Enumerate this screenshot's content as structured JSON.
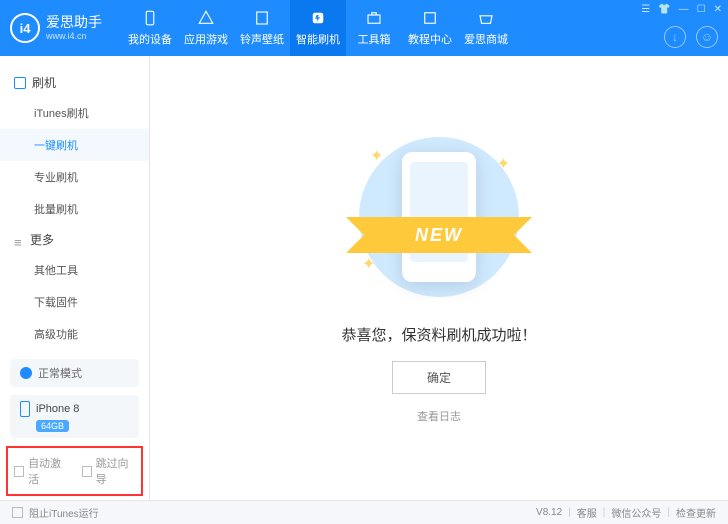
{
  "app": {
    "name": "爱思助手",
    "url": "www.i4.cn",
    "logo_text": "i4"
  },
  "nav": [
    {
      "label": "我的设备",
      "icon": "phone"
    },
    {
      "label": "应用游戏",
      "icon": "apps"
    },
    {
      "label": "铃声壁纸",
      "icon": "music"
    },
    {
      "label": "智能刷机",
      "icon": "flash",
      "active": true
    },
    {
      "label": "工具箱",
      "icon": "toolbox"
    },
    {
      "label": "教程中心",
      "icon": "book"
    },
    {
      "label": "爱思商城",
      "icon": "shop"
    }
  ],
  "sidebar": {
    "groups": [
      {
        "title": "刷机",
        "items": [
          "iTunes刷机",
          "一键刷机",
          "专业刷机",
          "批量刷机"
        ],
        "active_index": 1
      },
      {
        "title": "更多",
        "items": [
          "其他工具",
          "下载固件",
          "高级功能"
        ]
      }
    ],
    "mode": "正常模式",
    "device": {
      "name": "iPhone 8",
      "storage": "64GB"
    },
    "checks": [
      "自动激活",
      "跳过向导"
    ]
  },
  "main": {
    "ribbon": "NEW",
    "message": "恭喜您，保资料刷机成功啦！",
    "confirm": "确定",
    "log_link": "查看日志"
  },
  "footer": {
    "block_itunes": "阻止iTunes运行",
    "version": "V8.12",
    "links": [
      "客服",
      "微信公众号",
      "检查更新"
    ]
  }
}
